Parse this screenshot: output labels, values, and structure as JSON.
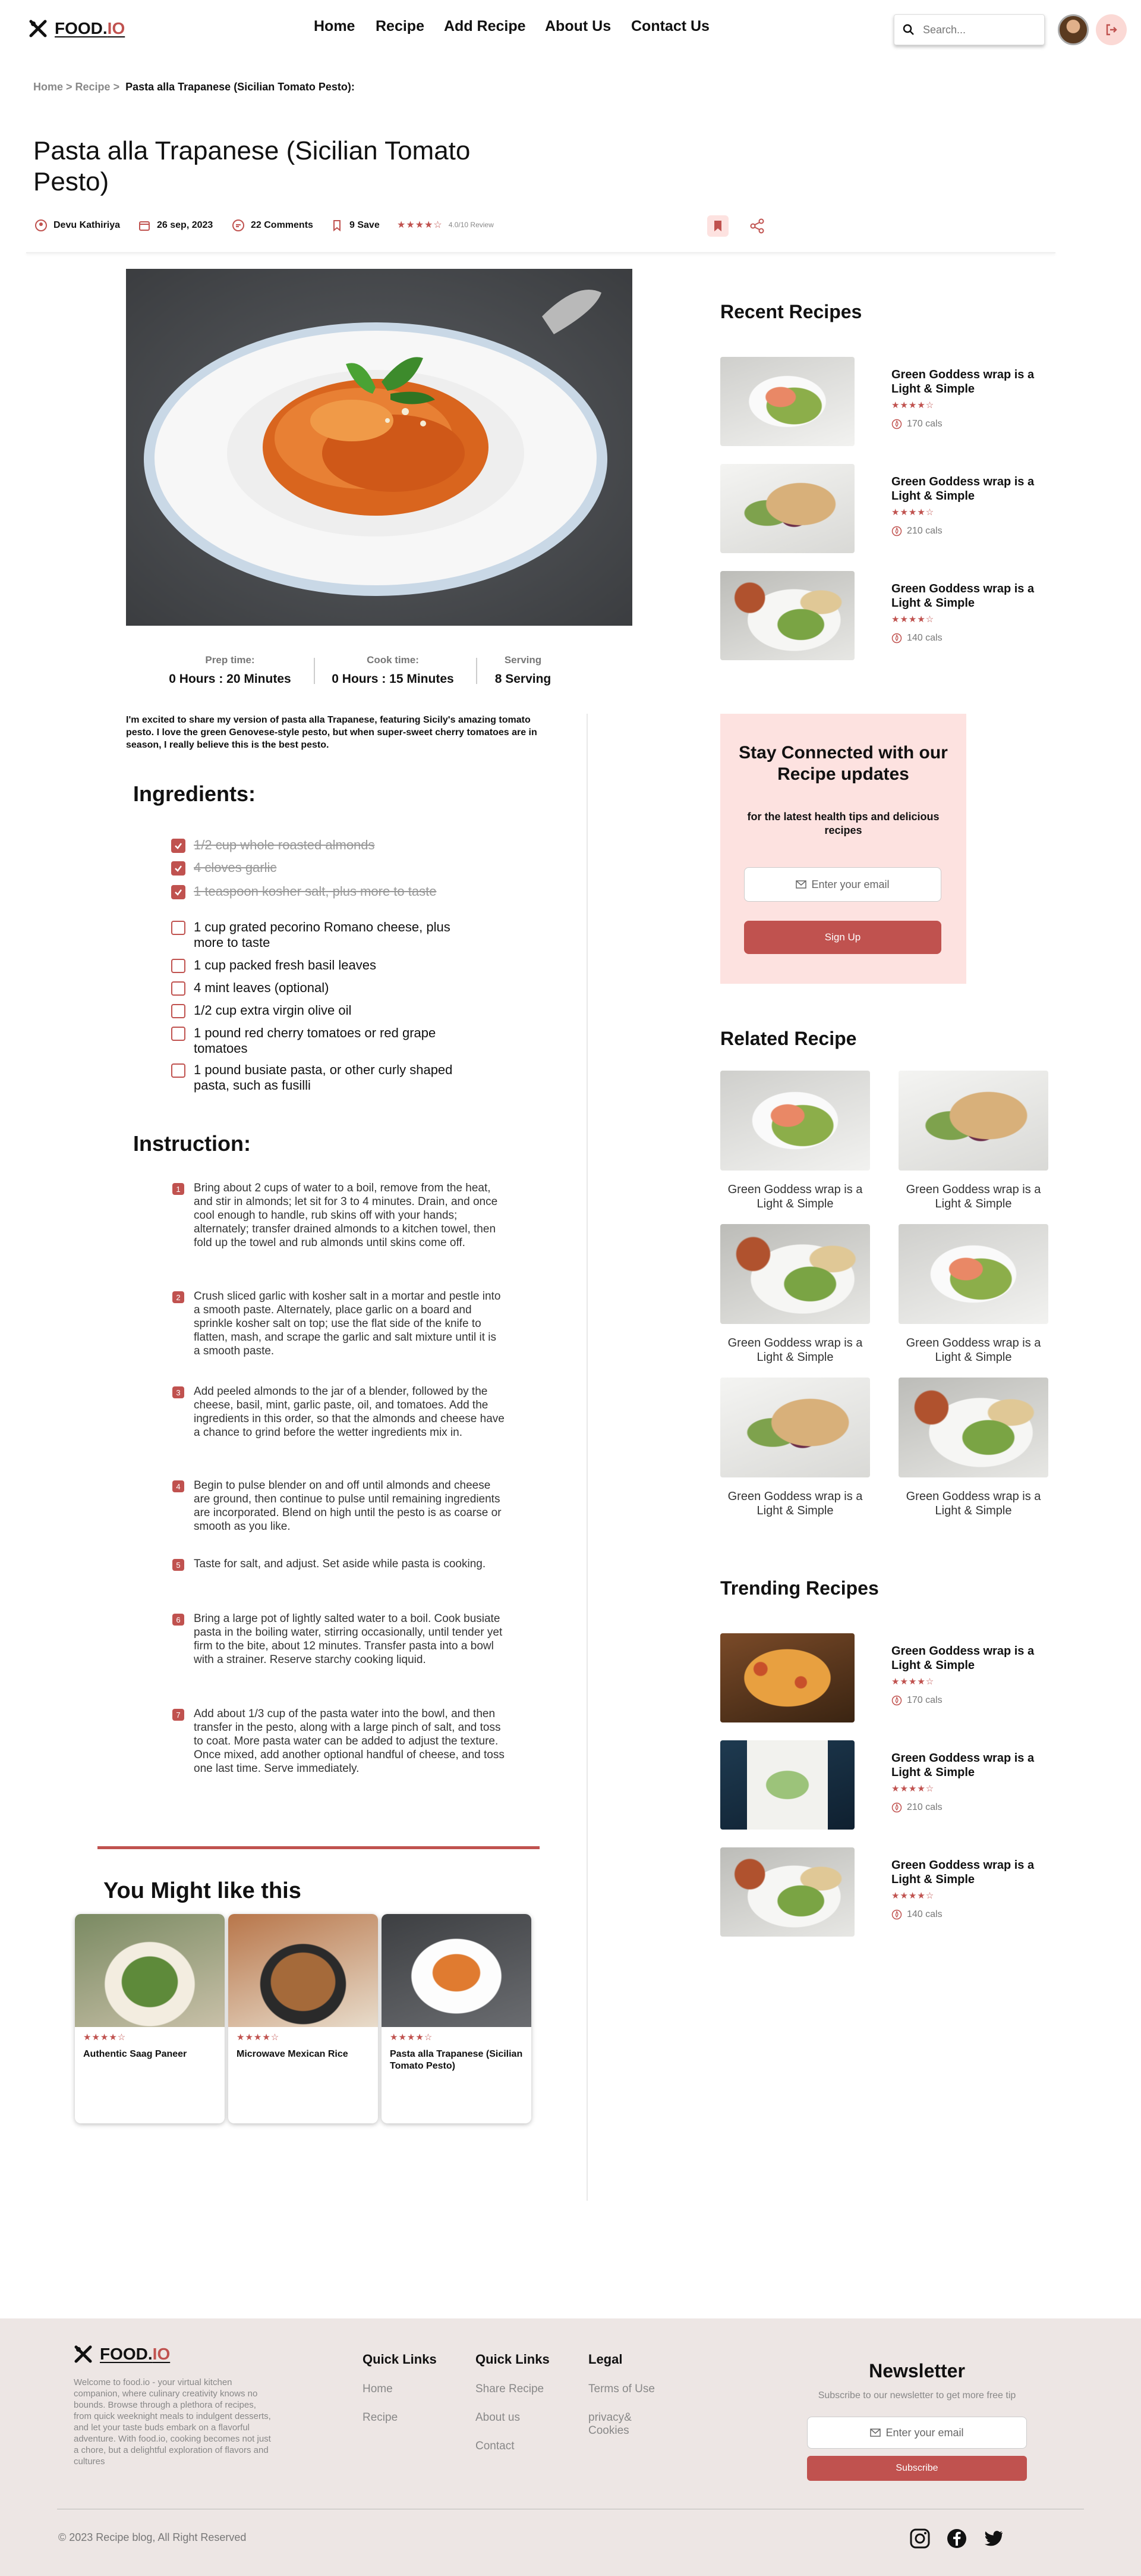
{
  "header": {
    "logo_text": "FOOD.",
    "logo_accent": "IO",
    "nav": [
      "Home",
      "Recipe",
      "Add Recipe",
      "About Us",
      "Contact Us"
    ],
    "search_placeholder": "Search..."
  },
  "breadcrumb": {
    "home": "Home",
    "recipe": "Recipe",
    "current": "Pasta alla Trapanese (Sicilian Tomato Pesto):"
  },
  "recipe": {
    "title": "Pasta alla Trapanese (Sicilian Tomato Pesto)",
    "author": "Devu Kathiriya",
    "date": "26 sep, 2023",
    "comments": "22 Comments",
    "saves": "9 Save",
    "rating_stars": "★★★★☆",
    "rating_text": "4.0/10 Review",
    "prep_label": "Prep time:",
    "prep_value": "0 Hours : 20 Minutes",
    "cook_label": "Cook time:",
    "cook_value": "0 Hours : 15 Minutes",
    "serving_label": "Serving",
    "serving_value": "8 Serving",
    "intro": "I'm excited to share my version of pasta alla Trapanese, featuring Sicily's amazing tomato pesto. I love the green Genovese-style pesto, but when super-sweet cherry tomatoes are in season, I really believe this is the best pesto.",
    "ingredients_heading": "Ingredients:",
    "ingredients": [
      {
        "text": "1/2 cup whole roasted almonds",
        "checked": true
      },
      {
        "text": "4 cloves garlic",
        "checked": true
      },
      {
        "text": "1 teaspoon kosher salt, plus more to taste",
        "checked": true
      },
      {
        "text": "1 cup grated pecorino Romano cheese, plus more to taste",
        "checked": false
      },
      {
        "text": "1 cup packed fresh basil leaves",
        "checked": false
      },
      {
        "text": "4 mint leaves (optional)",
        "checked": false
      },
      {
        "text": "1/2 cup extra virgin olive oil",
        "checked": false
      },
      {
        "text": "1 pound red cherry tomatoes or red grape tomatoes",
        "checked": false
      },
      {
        "text": "1 pound busiate pasta, or other curly shaped pasta, such as fusilli",
        "checked": false
      }
    ],
    "instruction_heading": "Instruction:",
    "steps": [
      "Bring about 2 cups of water to a boil, remove from the heat, and stir in almonds; let sit for 3 to 4 minutes. Drain, and once cool enough to handle, rub skins off with your hands; alternately; transfer drained almonds to a kitchen towel, then fold up the towel and rub almonds until skins come off.",
      "Crush sliced garlic with kosher salt in a mortar and pestle into a smooth paste. Alternately, place garlic on a board and sprinkle kosher salt on top; use the flat side of the knife to flatten, mash, and scrape the garlic and salt mixture until it is a smooth paste.",
      "Add peeled almonds to the jar of a blender, followed by the cheese, basil, mint, garlic paste, oil, and tomatoes. Add the ingredients in this order, so that the almonds and cheese have a chance to grind before the wetter ingredients mix in.",
      "Begin to pulse blender on and off until almonds and cheese are ground, then continue to pulse until remaining ingredients are incorporated. Blend on high until the pesto is as coarse or smooth as you like.",
      "Taste for salt, and adjust. Set aside while pasta is cooking.",
      "Bring a large pot of lightly salted water to a boil. Cook busiate pasta in the boiling water, stirring occasionally, until tender yet firm to the bite, about 12 minutes. Transfer pasta into a bowl with a strainer. Reserve starchy cooking liquid.",
      "Add about 1/3 cup of the pasta water into the bowl, and then transfer in the pesto, along with a large pinch of salt, and toss to coat. More pasta water can be added to adjust the texture. Once mixed, add another optional handful of cheese, and toss one last time. Serve immediately."
    ]
  },
  "might_like": {
    "heading": "You Might like this",
    "cards": [
      {
        "name": "Authentic Saag Paneer",
        "stars": "★★★★☆"
      },
      {
        "name": "Microwave Mexican Rice",
        "stars": "★★★★☆"
      },
      {
        "name": "Pasta alla Trapanese (Sicilian Tomato Pesto)",
        "stars": "★★★★☆"
      }
    ]
  },
  "sidebar": {
    "recent_heading": "Recent Recipes",
    "recent": [
      {
        "name": "Green Goddess wrap is a Light & Simple",
        "stars": "★★★★☆",
        "cals": "170 cals"
      },
      {
        "name": "Green Goddess wrap is a Light & Simple",
        "stars": "★★★★☆",
        "cals": "210 cals"
      },
      {
        "name": "Green Goddess wrap is a Light & Simple",
        "stars": "★★★★☆",
        "cals": "140 cals"
      }
    ],
    "newsletter": {
      "heading": "Stay Connected with our Recipe updates",
      "sub": "for the latest health tips and delicious recipes",
      "placeholder": "Enter your email",
      "button": "Sign Up"
    },
    "related_heading": "Related Recipe",
    "related": [
      "Green Goddess wrap is a Light & Simple",
      "Green Goddess wrap is a Light & Simple",
      "Green Goddess wrap is a Light & Simple",
      "Green Goddess wrap is a Light & Simple",
      "Green Goddess wrap is a Light & Simple",
      "Green Goddess wrap is a Light & Simple"
    ],
    "trending_heading": "Trending Recipes",
    "trending": [
      {
        "name": "Green Goddess wrap is a Light & Simple",
        "stars": "★★★★☆",
        "cals": "170 cals"
      },
      {
        "name": "Green Goddess wrap is a Light & Simple",
        "stars": "★★★★☆",
        "cals": "210 cals"
      },
      {
        "name": "Green Goddess wrap is a Light & Simple",
        "stars": "★★★★☆",
        "cals": "140 cals"
      }
    ]
  },
  "footer": {
    "about": "Welcome to food.io - your virtual kitchen companion, where culinary creativity knows no bounds. Browse through a plethora of recipes, from quick weeknight meals to indulgent desserts, and let your taste buds embark on a flavorful adventure. With food.io, cooking becomes not just a chore, but a delightful exploration of flavors and cultures",
    "quick_links_1_heading": "Quick Links",
    "quick_links_1": [
      "Home",
      "Recipe"
    ],
    "quick_links_2_heading": "Quick Links",
    "quick_links_2": [
      "Share Recipe",
      "About us",
      "Contact"
    ],
    "legal_heading": "Legal",
    "legal": [
      "Terms of Use",
      "privacy& Cookies"
    ],
    "newsletter_heading": "Newsletter",
    "newsletter_sub": "Subscribe to our newsletter to get more free tip",
    "newsletter_placeholder": "Enter your email",
    "newsletter_button": "Subscribe",
    "copyright": "© 2023 Recipe blog, All Right Reserved"
  },
  "colors": {
    "accent": "#c0524f",
    "newsletter_bg": "#fde2e0",
    "footer_bg": "#ede6e4"
  }
}
